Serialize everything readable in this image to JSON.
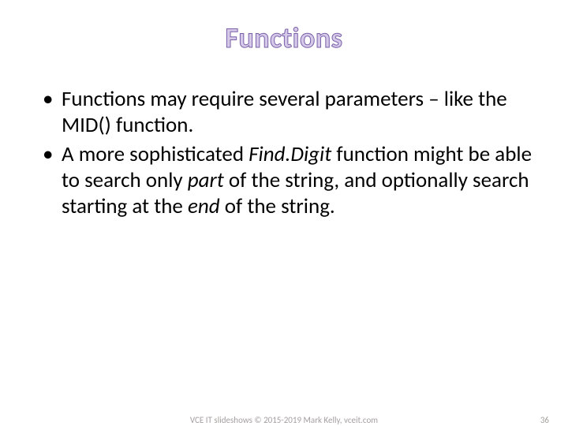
{
  "title": "Functions",
  "bullets": [
    {
      "segments": [
        {
          "text": "Functions may require several parameters – like the MID() function.",
          "italic": false
        }
      ]
    },
    {
      "segments": [
        {
          "text": "A more sophisticated ",
          "italic": false
        },
        {
          "text": "Find.Digit",
          "italic": true
        },
        {
          "text": " function might be able to search only ",
          "italic": false
        },
        {
          "text": "part",
          "italic": true
        },
        {
          "text": " of the string, and optionally search starting at the ",
          "italic": false
        },
        {
          "text": "end",
          "italic": true
        },
        {
          "text": " of the string.",
          "italic": false
        }
      ]
    }
  ],
  "footer": {
    "center": "VCE IT slideshows © 2015-2019 Mark Kelly, vceit.com",
    "page": "36"
  }
}
